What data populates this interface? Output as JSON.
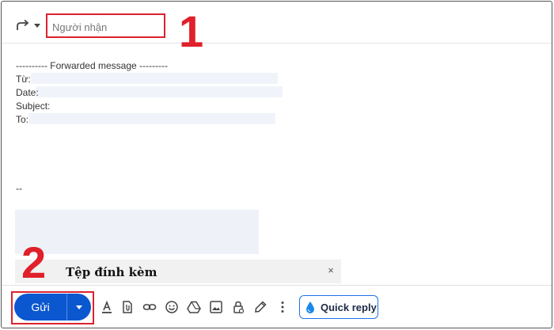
{
  "compose": {
    "recipient_placeholder": "Người nhận",
    "forward_icon": "forward-arrow-icon"
  },
  "annotations": {
    "step1": "1",
    "step2": "2",
    "highlight_color": "#d9232e"
  },
  "message": {
    "forwarded_header": "---------- Forwarded message ---------",
    "fields": {
      "from_label": "Từ:",
      "date_label": "Date:",
      "subject_label": "Subject:",
      "to_label": "To:"
    },
    "signature_sep": "--"
  },
  "attachment": {
    "label": "Tệp đính kèm",
    "close": "×"
  },
  "toolbar": {
    "send_label": "Gửi",
    "send_color": "#0b57d0",
    "quick_reply_label": "Quick reply",
    "icons": [
      "text-format-icon",
      "attach-file-icon",
      "insert-link-icon",
      "emoji-icon",
      "drive-icon",
      "insert-photo-icon",
      "confidential-mode-icon",
      "signature-pen-icon",
      "more-options-icon"
    ]
  }
}
